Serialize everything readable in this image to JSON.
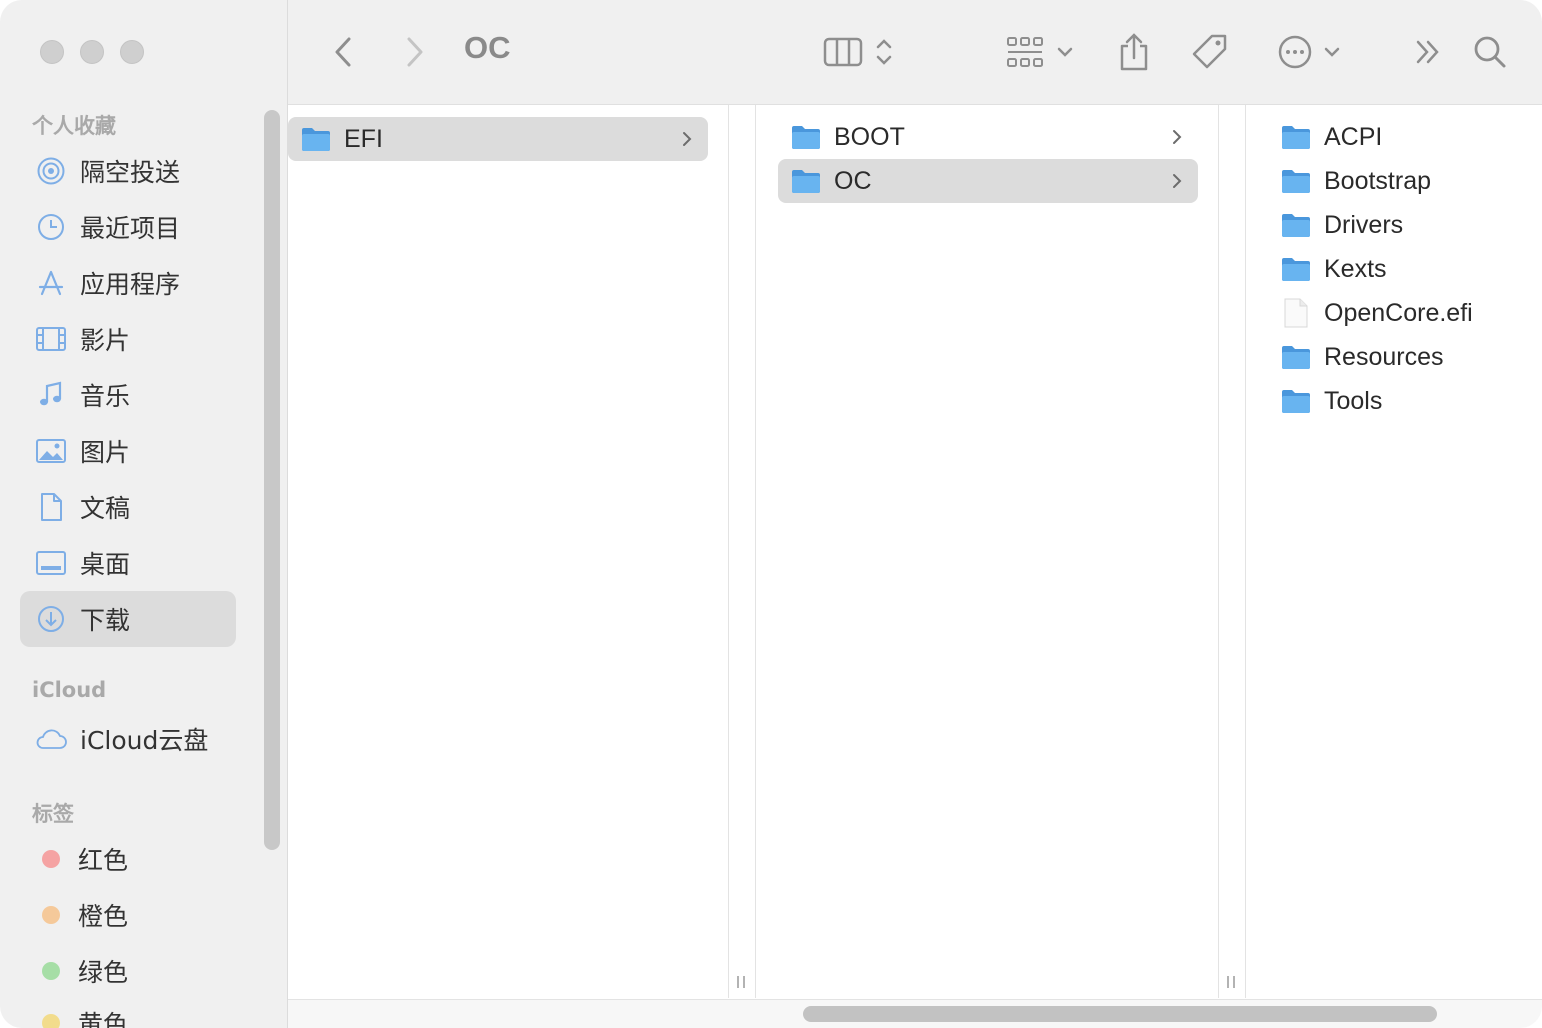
{
  "window": {
    "title": "OC"
  },
  "sidebar": {
    "favorites_title": "个人收藏",
    "favorites": [
      {
        "label": "隔空投送",
        "icon": "airdrop-icon"
      },
      {
        "label": "最近项目",
        "icon": "clock-icon"
      },
      {
        "label": "应用程序",
        "icon": "applications-icon"
      },
      {
        "label": "影片",
        "icon": "film-icon"
      },
      {
        "label": "音乐",
        "icon": "music-note-icon"
      },
      {
        "label": "图片",
        "icon": "photo-icon"
      },
      {
        "label": "文稿",
        "icon": "document-icon"
      },
      {
        "label": "桌面",
        "icon": "desktop-icon"
      },
      {
        "label": "下载",
        "icon": "download-icon",
        "selected": true
      }
    ],
    "icloud_title": "iCloud",
    "icloud": [
      {
        "label": "iCloud云盘",
        "icon": "cloud-icon"
      }
    ],
    "tags_title": "标签",
    "tags": [
      {
        "label": "红色",
        "color": "#f5a3a3"
      },
      {
        "label": "橙色",
        "color": "#f5c99a"
      },
      {
        "label": "绿色",
        "color": "#a6dea6"
      },
      {
        "label": "黄色",
        "color": "#f2dc8c"
      }
    ]
  },
  "columns": [
    {
      "items": [
        {
          "name": "EFI",
          "type": "folder",
          "selected": true,
          "has_children": true
        }
      ]
    },
    {
      "items": [
        {
          "name": "BOOT",
          "type": "folder",
          "has_children": true
        },
        {
          "name": "OC",
          "type": "folder",
          "selected": true,
          "has_children": true
        }
      ]
    },
    {
      "items": [
        {
          "name": "ACPI",
          "type": "folder"
        },
        {
          "name": "Bootstrap",
          "type": "folder"
        },
        {
          "name": "Drivers",
          "type": "folder"
        },
        {
          "name": "Kexts",
          "type": "folder"
        },
        {
          "name": "OpenCore.efi",
          "type": "file"
        },
        {
          "name": "Resources",
          "type": "folder"
        },
        {
          "name": "Tools",
          "type": "folder"
        }
      ]
    }
  ],
  "colors": {
    "folder": "#5aa9ea",
    "sidebar_icon": "#7eaee6",
    "selection": "#dcdcdc"
  }
}
